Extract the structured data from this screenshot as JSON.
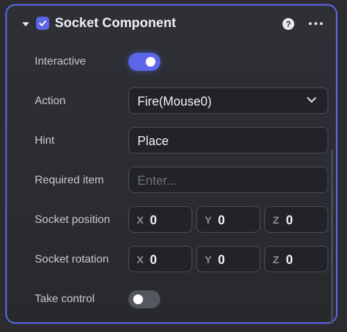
{
  "component": {
    "title": "Socket Component",
    "enabled": true,
    "collapsed": false,
    "help_icon": "question-circle-icon",
    "more_icon": "more-horizontal-icon"
  },
  "properties": {
    "interactive": {
      "label": "Interactive",
      "value": true
    },
    "action": {
      "label": "Action",
      "value": "Fire(Mouse0)"
    },
    "hint": {
      "label": "Hint",
      "value": "Place"
    },
    "required_item": {
      "label": "Required item",
      "value": "",
      "placeholder": "Enter..."
    },
    "socket_position": {
      "label": "Socket position",
      "x_axis": "X",
      "y_axis": "Y",
      "z_axis": "Z",
      "x": "0",
      "y": "0",
      "z": "0"
    },
    "socket_rotation": {
      "label": "Socket rotation",
      "x_axis": "X",
      "y_axis": "Y",
      "z_axis": "Z",
      "x": "0",
      "y": "0",
      "z": "0"
    },
    "take_control": {
      "label": "Take control",
      "value": false
    }
  },
  "colors": {
    "accent": "#5b66e8",
    "panel_bg": "#2e3036",
    "field_bg": "#222328",
    "label_text": "#c9cad1"
  }
}
